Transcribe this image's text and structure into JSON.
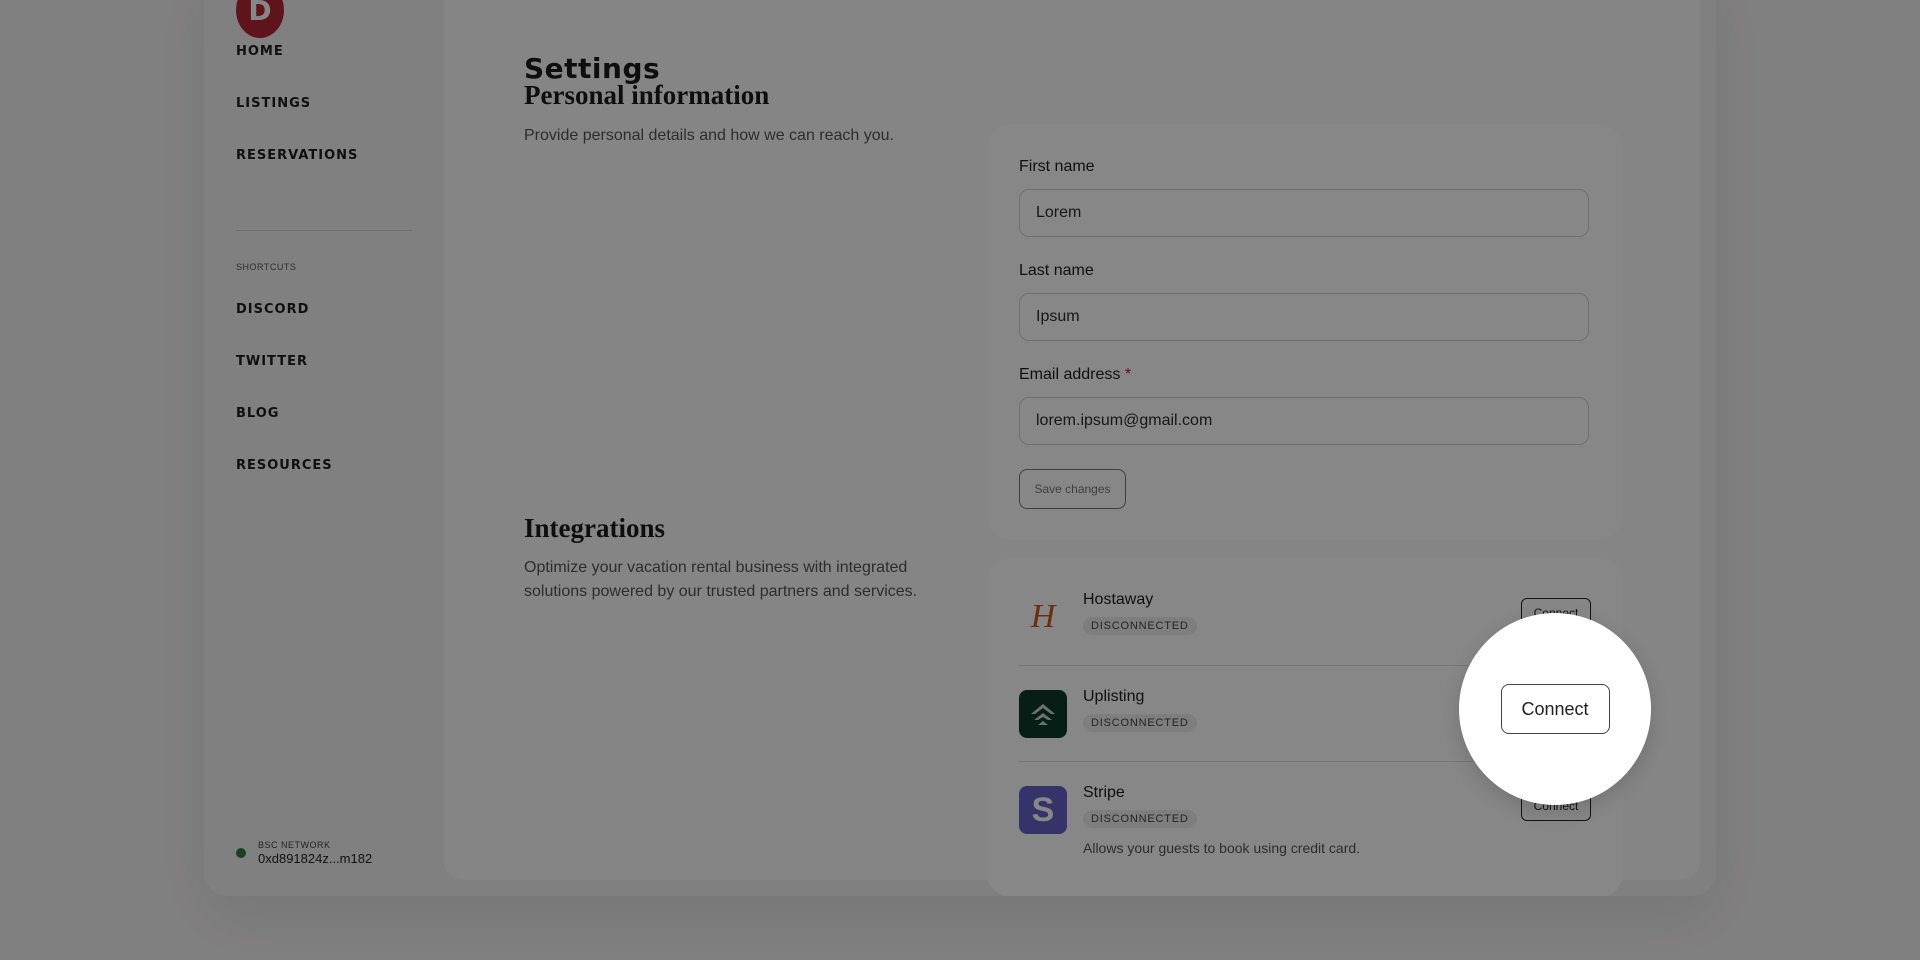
{
  "brand": {
    "logo_letter": "D",
    "logo_color": "#b32533"
  },
  "sidebar": {
    "nav": [
      {
        "label": "HOME"
      },
      {
        "label": "LISTINGS"
      },
      {
        "label": "RESERVATIONS"
      }
    ],
    "shortcuts_label": "SHORTCUTS",
    "shortcuts": [
      {
        "label": "DISCORD"
      },
      {
        "label": "TWITTER"
      },
      {
        "label": "BLOG"
      },
      {
        "label": "RESOURCES"
      }
    ],
    "wallet": {
      "network": "BSC NETWORK",
      "address": "0xd891824z...m182",
      "status_color": "#2f7d43"
    }
  },
  "main": {
    "title": "Settings",
    "personal": {
      "title": "Personal information",
      "description": "Provide personal details and how we can reach you.",
      "fields": {
        "first_name": {
          "label": "First name",
          "value": "Lorem"
        },
        "last_name": {
          "label": "Last name",
          "value": "Ipsum"
        },
        "email": {
          "label": "Email address",
          "required_mark": "*",
          "value": "lorem.ipsum@gmail.com"
        }
      },
      "save_label": "Save changes"
    },
    "integrations": {
      "title": "Integrations",
      "description": "Optimize your vacation rental business with integrated solutions powered by our trusted partners and services.",
      "items": [
        {
          "name": "Hostaway",
          "status": "DISCONNECTED",
          "icon": "hostaway-logo-icon",
          "glyph": "H",
          "action": "Connect"
        },
        {
          "name": "Uplisting",
          "status": "DISCONNECTED",
          "icon": "uplisting-logo-icon",
          "action": "Connect"
        },
        {
          "name": "Stripe",
          "status": "DISCONNECTED",
          "icon": "stripe-logo-icon",
          "glyph": "S",
          "description": "Allows your guests to book using credit card.",
          "action": "Connect"
        }
      ]
    }
  },
  "spotlight": {
    "button_label": "Connect"
  }
}
